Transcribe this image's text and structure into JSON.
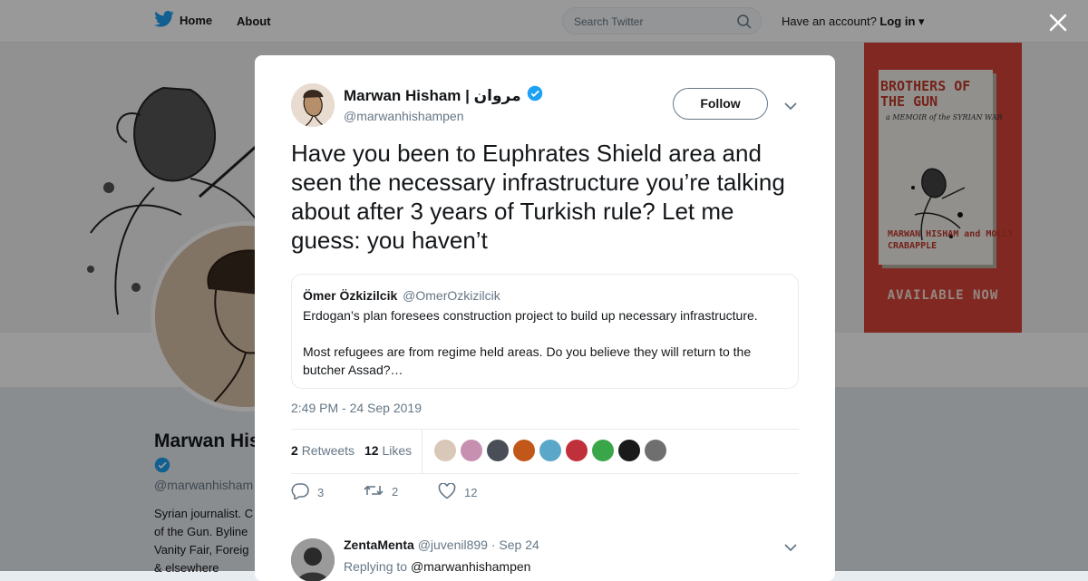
{
  "nav": {
    "home_label": "Home",
    "about_label": "About"
  },
  "search": {
    "placeholder": "Search Twitter"
  },
  "account": {
    "prompt": "Have an account?",
    "login_label": "Log in"
  },
  "banner": {
    "book_title": "BROTHERS OF THE GUN",
    "book_subtitle": "a MEMOIR of the SYRIAN WAR",
    "book_authors": "MARWAN HISHAM and MOLLY CRABAPPLE",
    "book_tagline": "AVAILABLE NOW"
  },
  "profile": {
    "name": "Marwan His",
    "handle": "@marwanhisham",
    "bio_lines": [
      "Syrian journalist. C",
      "of the Gun. Byline",
      "Vanity Fair, Foreig",
      "& elsewhere"
    ]
  },
  "tweet": {
    "author_name": "Marwan Hisham | مروان",
    "author_handle": "@marwanhishampen",
    "follow_label": "Follow",
    "text": "Have you been to Euphrates Shield area and seen the necessary infrastructure you’re talking about after 3 years of Turkish rule? Let me guess: you haven’t",
    "quoted": {
      "name": "Ömer Özkizilcik",
      "handle": "@OmerOzkizilcik",
      "line1": "Erdogan’s plan foresees construction project to build up necessary infrastructure.",
      "line2": "Most refugees are from regime held areas. Do you believe they will return to the butcher Assad?…"
    },
    "timestamp": "2:49 PM - 24 Sep 2019",
    "retweets_count": "2",
    "retweets_label": "Retweets",
    "likes_count": "12",
    "likes_label": "Likes",
    "likers_colors": [
      "#d9c7b8",
      "#c78fb0",
      "#4a4f57",
      "#c2571a",
      "#5aa7c9",
      "#c0303a",
      "#3aa64a",
      "#1a1a1a",
      "#6f6f6f"
    ],
    "actions": {
      "replies": "3",
      "retweets": "2",
      "likes": "12"
    }
  },
  "reply": {
    "name": "ZentaMenta",
    "handle": "@juvenil899",
    "date": "· Sep 24",
    "replying_prefix": "Replying to",
    "replying_to": "@marwanhishampen"
  },
  "colors": {
    "accent": "#1da1f2",
    "muted": "#657786",
    "text": "#14171a",
    "book_red": "#d9433a"
  }
}
